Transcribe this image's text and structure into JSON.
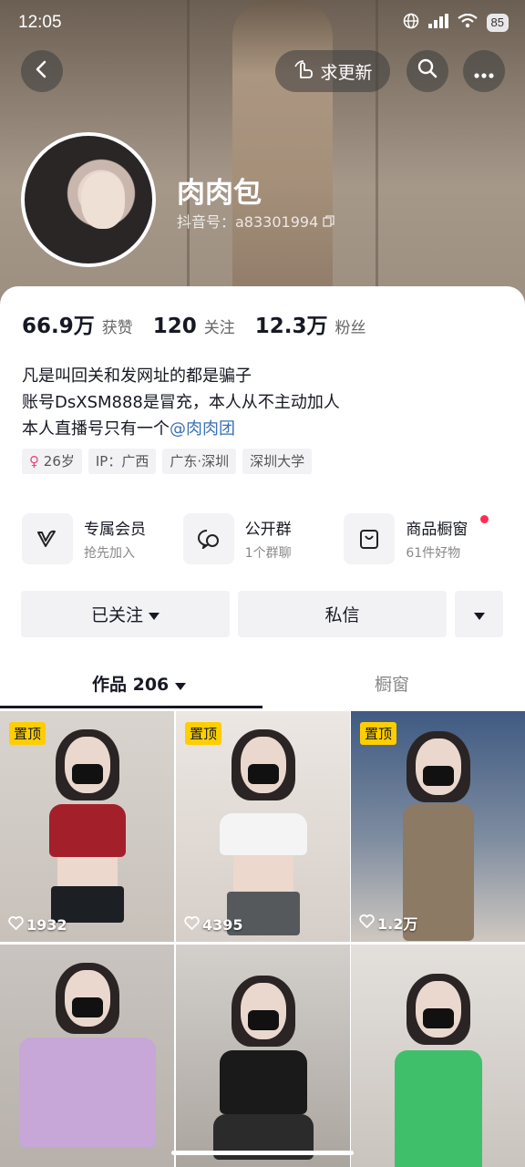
{
  "status_bar": {
    "time": "12:05",
    "battery": "85"
  },
  "header": {
    "update_label": "求更新",
    "nickname": "肉肉包",
    "douyin_id": "抖音号：a83301994"
  },
  "stats": [
    {
      "value": "66.9万",
      "label": "获赞"
    },
    {
      "value": "120",
      "label": "关注"
    },
    {
      "value": "12.3万",
      "label": "粉丝"
    }
  ],
  "bio": {
    "line1": "凡是叫回关和发网址的都是骗子",
    "line2": "账号DsXSM888是冒充，本人从不主动加人",
    "line3_prefix": "本人直播号只有一个",
    "line3_mention": "@肉肉团"
  },
  "tags": {
    "age": "26岁",
    "ip": "IP：广西",
    "location": "广东·深圳",
    "school": "深圳大学"
  },
  "features": [
    {
      "title": "专属会员",
      "sub": "抢先加入",
      "icon": "v-badge-icon"
    },
    {
      "title": "公开群",
      "sub": "1个群聊",
      "icon": "chat-group-icon"
    },
    {
      "title": "商品橱窗",
      "sub": "61件好物",
      "icon": "shop-bag-icon"
    }
  ],
  "actions": {
    "follow": "已关注",
    "message": "私信"
  },
  "tabs": {
    "works": "作品 206",
    "showcase": "橱窗"
  },
  "videos": [
    {
      "pinned": "置顶",
      "likes": "1932"
    },
    {
      "pinned": "置顶",
      "likes": "4395"
    },
    {
      "pinned": "置顶",
      "likes": "1.2万"
    },
    {
      "pinned": "",
      "likes": ""
    },
    {
      "pinned": "",
      "likes": ""
    },
    {
      "pinned": "",
      "likes": ""
    }
  ],
  "colors": {
    "accent": "#fe2c55",
    "pin_bg": "#fece00",
    "mention": "#3a6fb5"
  }
}
